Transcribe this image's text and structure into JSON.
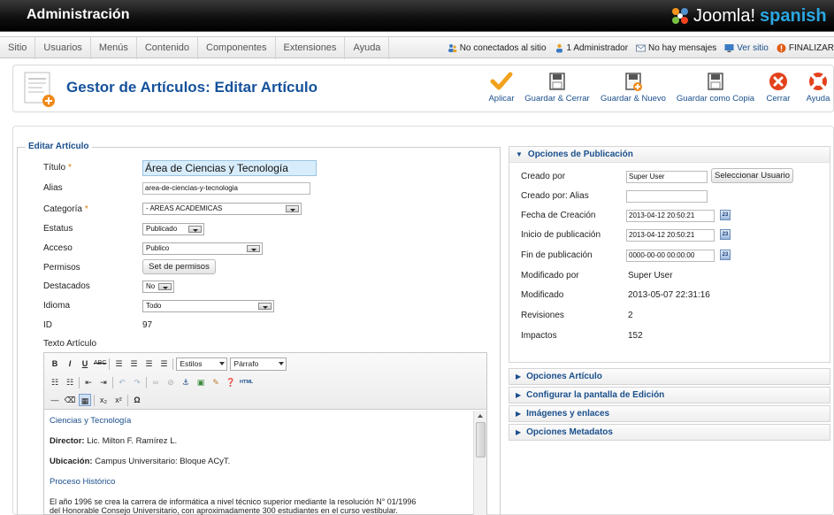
{
  "header": {
    "admin_title": "Administración",
    "logo_word": "Joomla!",
    "logo_sub": "spanish"
  },
  "menu": {
    "items": [
      "Sitio",
      "Usuarios",
      "Menús",
      "Contenido",
      "Componentes",
      "Extensiones",
      "Ayuda"
    ]
  },
  "status": {
    "visitors": "No conectados al sitio",
    "admins": "1 Administrador",
    "messages": "No hay mensajes",
    "view_site": "Ver sitio",
    "logout": "FINALIZAR"
  },
  "toolbar": {
    "page_title": "Gestor de Artículos: Editar Artículo",
    "apply": "Aplicar",
    "save_close": "Guardar & Cerrar",
    "save_new": "Guardar & Nuevo",
    "save_copy": "Guardar como Copia",
    "close": "Cerrar",
    "help": "Ayuda"
  },
  "form": {
    "legend": "Editar Artículo",
    "title_label": "Título",
    "title_value": "Área de Ciencias y Tecnología",
    "alias_label": "Alias",
    "alias_value": "area-de-ciencias-y-tecnologia",
    "category_label": "Categoría",
    "category_value": "- AREAS ACADEMICAS",
    "status_label": "Estatus",
    "status_value": "Publicado",
    "access_label": "Acceso",
    "access_value": "Publico",
    "permissions_label": "Permisos",
    "permissions_button": "Set de permisos",
    "featured_label": "Destacados",
    "featured_value": "No",
    "language_label": "Idioma",
    "language_value": "Todo",
    "id_label": "ID",
    "id_value": "97",
    "text_label": "Texto Artículo"
  },
  "editor": {
    "styles_select": "Estilos",
    "format_select": "Párrafo",
    "html_label": "HTML",
    "p1": "Ciencias y Tecnología",
    "director_label": "Director:",
    "director_value": "Lic. Milton F. Ramírez L.",
    "location_label": "Ubicación:",
    "location_value": "Campus Universitario: Bloque ACyT.",
    "history_heading": "Proceso Histórico",
    "history_line1": "El año 1996 se crea la carrera de informática a nivel técnico superior mediante la resolución N° 01/1996",
    "history_line2": "del Honorable Consejo Universitario, con aproximadamente 300 estudiantes en el curso vestibular."
  },
  "publishing": {
    "heading": "Opciones de Publicación",
    "created_by_label": "Creado por",
    "created_by_value": "Super User",
    "select_user_button": "Seleccionar Usuario",
    "created_alias_label": "Creado por: Alias",
    "created_alias_value": "",
    "created_date_label": "Fecha de Creación",
    "created_date_value": "2013-04-12 20:50:21",
    "publish_up_label": "Inicio de publicación",
    "publish_up_value": "2013-04-12 20:50:21",
    "publish_down_label": "Fin de publicación",
    "publish_down_value": "0000-00-00 00:00:00",
    "modified_by_label": "Modificado por",
    "modified_by_value": "Super User",
    "modified_label": "Modificado",
    "modified_value": "2013-05-07 22:31:16",
    "revisions_label": "Revisiones",
    "revisions_value": "2",
    "hits_label": "Impactos",
    "hits_value": "152",
    "calendar_label": "23"
  },
  "panels": {
    "article_options": "Opciones Artículo",
    "edit_screen": "Configurar la pantalla de Edición",
    "images_links": "Imágenes y enlaces",
    "metadata": "Opciones Metadatos"
  },
  "colors": {
    "accent": "#15519b",
    "link": "#1a4f8c",
    "header_bg": "#000000",
    "logo_blue": "#2aa7e2",
    "required": "#e07b00"
  }
}
